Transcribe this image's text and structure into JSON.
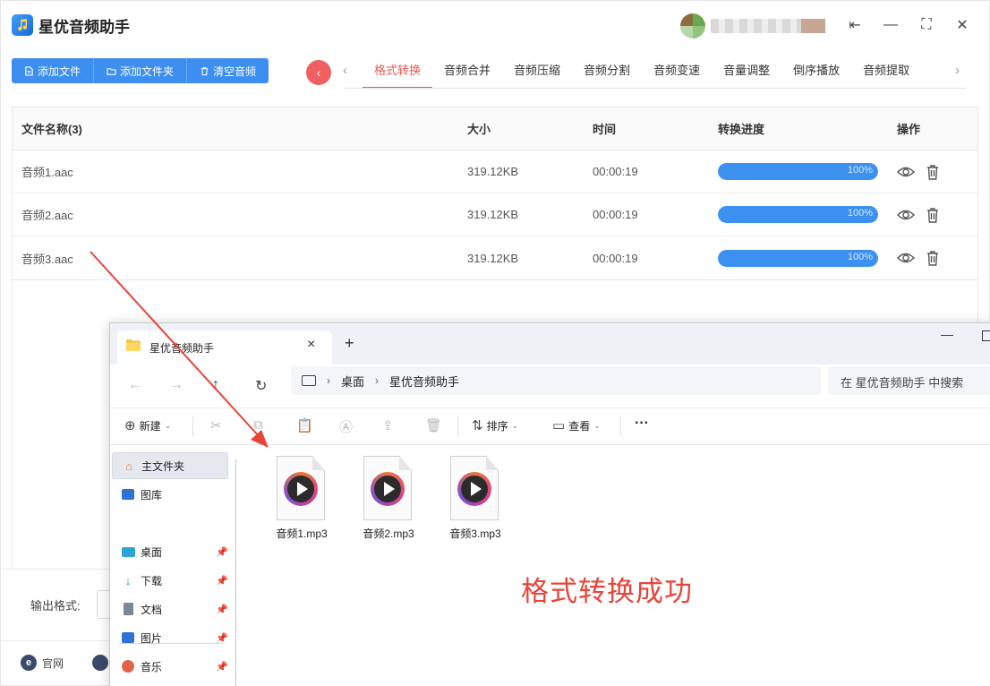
{
  "app": {
    "title": "星优音频助手",
    "win_controls": {
      "pin": "⇤",
      "minimize": "—",
      "maximize": "⛶",
      "close": "✕"
    }
  },
  "toolbar": {
    "add_file": "添加文件",
    "add_folder": "添加文件夹",
    "clear_audio": "清空音频"
  },
  "tabs": [
    "格式转换",
    "音频合并",
    "音频压缩",
    "音频分割",
    "音频变速",
    "音量调整",
    "倒序播放",
    "音频提取"
  ],
  "active_tab": 0,
  "table": {
    "headers": {
      "name": "文件名称(3)",
      "size": "大小",
      "time": "时间",
      "progress": "转换进度",
      "ops": "操作"
    },
    "rows": [
      {
        "name": "音频1.aac",
        "size": "319.12KB",
        "time": "00:00:19",
        "progress": 100,
        "progress_text": "100%"
      },
      {
        "name": "音频2.aac",
        "size": "319.12KB",
        "time": "00:00:19",
        "progress": 100,
        "progress_text": "100%"
      },
      {
        "name": "音频3.aac",
        "size": "319.12KB",
        "time": "00:00:19",
        "progress": 100,
        "progress_text": "100%"
      }
    ]
  },
  "output": {
    "label": "输出格式:"
  },
  "footer": {
    "site_label": "官网",
    "site_icon": "e"
  },
  "explorer": {
    "tab_title": "星优音频助手",
    "breadcrumb": [
      "桌面",
      "星优音频助手"
    ],
    "search_placeholder": "在 星优音频助手 中搜索",
    "commands": {
      "new": "新建",
      "sort": "排序",
      "view": "查看",
      "more": "···"
    },
    "sidebar": [
      {
        "label": "主文件夹",
        "icon": "home-icon",
        "pinned": false
      },
      {
        "label": "图库",
        "icon": "gallery-icon",
        "pinned": false
      },
      {
        "label": "桌面",
        "icon": "desktop-icon",
        "pinned": true
      },
      {
        "label": "下载",
        "icon": "download-icon",
        "pinned": true
      },
      {
        "label": "文档",
        "icon": "document-icon",
        "pinned": true
      },
      {
        "label": "图片",
        "icon": "pictures-icon",
        "pinned": true
      },
      {
        "label": "音乐",
        "icon": "music-icon",
        "pinned": true
      }
    ],
    "files": [
      "音频1.mp3",
      "音频2.mp3",
      "音频3.mp3"
    ]
  },
  "annotation": {
    "success_text": "格式转换成功"
  },
  "colors": {
    "accent": "#e85a4f",
    "primary": "#3c8ef0",
    "success_text": "#e8443a"
  }
}
